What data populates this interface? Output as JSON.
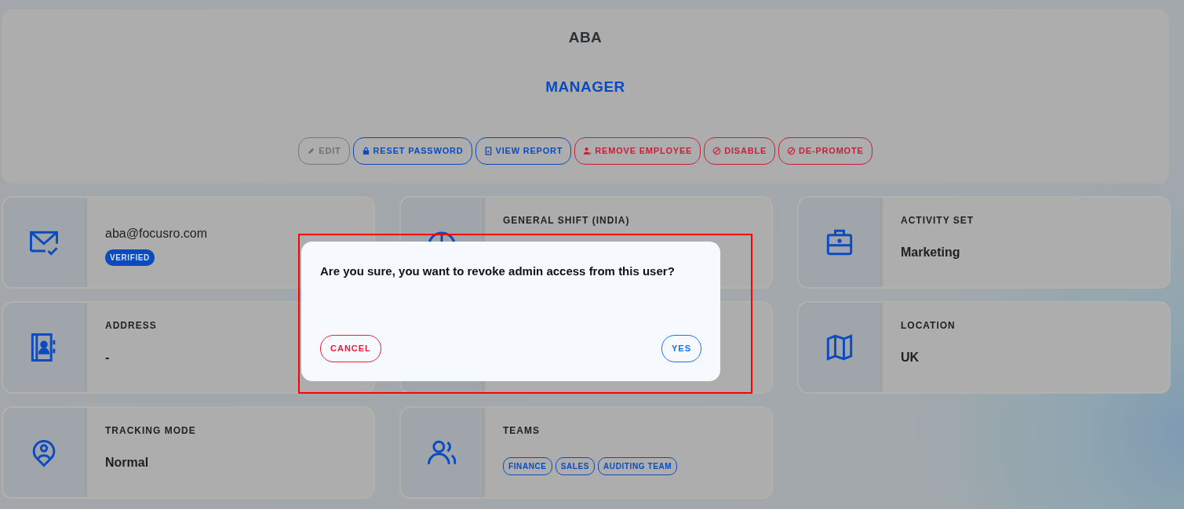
{
  "profile": {
    "name": "ABA",
    "role": "MANAGER"
  },
  "actions": [
    {
      "label": "EDIT",
      "kind": "neutral"
    },
    {
      "label": "RESET PASSWORD",
      "kind": "primary"
    },
    {
      "label": "VIEW REPORT",
      "kind": "primary"
    },
    {
      "label": "REMOVE EMPLOYEE",
      "kind": "danger"
    },
    {
      "label": "DISABLE",
      "kind": "danger"
    },
    {
      "label": "DE-PROMOTE",
      "kind": "danger"
    }
  ],
  "cards": [
    {
      "kind": "email",
      "value": "aba@focusro.com",
      "badge": "VERIFIED"
    },
    {
      "kind": "field",
      "label": "GENERAL SHIFT (INDIA)"
    },
    {
      "kind": "field",
      "label": "ACTIVITY SET",
      "value": "Marketing"
    },
    {
      "kind": "field",
      "label": "ADDRESS",
      "value": "-"
    },
    {
      "kind": "covered"
    },
    {
      "kind": "field",
      "label": "LOCATION",
      "value": "UK"
    },
    {
      "kind": "field",
      "label": "TRACKING MODE",
      "value": "Normal"
    },
    {
      "kind": "tags",
      "label": "TEAMS",
      "tags": [
        "FINANCE",
        "SALES",
        "AUDITING TEAM"
      ]
    }
  ],
  "dialog": {
    "message": "Are you sure, you want to revoke admin access from this user?",
    "buttons": [
      {
        "label": "CANCEL",
        "kind": "danger"
      },
      {
        "label": "YES",
        "kind": "primary"
      }
    ]
  }
}
